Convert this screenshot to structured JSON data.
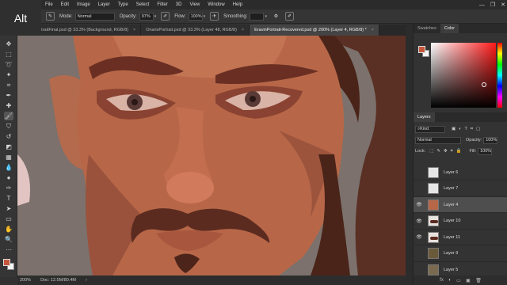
{
  "overlay": {
    "key_label": "Alt"
  },
  "menu": {
    "logo": "Ps",
    "items": [
      "File",
      "Edit",
      "Image",
      "Layer",
      "Type",
      "Select",
      "Filter",
      "3D",
      "View",
      "Window",
      "Help"
    ],
    "window_controls": [
      "—",
      "❐",
      "✕"
    ]
  },
  "options": {
    "mode_label": "Mode:",
    "mode_value": "Normal",
    "opacity_label": "Opacity:",
    "opacity_value": "97%",
    "flow_label": "Flow:",
    "flow_value": "100%",
    "smoothing_label": "Smoothing:",
    "smoothing_value": ""
  },
  "tabs": [
    {
      "label": "EravinPortraitFinal.psd @ 33.3% (Background, RGB/8)",
      "close": "×"
    },
    {
      "label": "OnarisPortrait.psd @ 33.3% (Layer 48, RGB/8)",
      "close": "×"
    },
    {
      "label": "EravinPortrait-Recovered.psd @ 200% (Layer 4, RGB/8) *",
      "close": "×"
    }
  ],
  "status": {
    "zoom": "200%",
    "doc": "Doc: 12.5M/80.4M",
    "arrow": "›"
  },
  "panels": {
    "top_tabs": [
      "Swatches",
      "Color"
    ],
    "layers_tab": "Layers",
    "kind_filter": "Kind",
    "blend_mode": "Normal",
    "opacity_label": "Opacity:",
    "opacity_value": "100%",
    "lock_label": "Lock:",
    "fill_label": "Fill:",
    "fill_value": "100%",
    "layers": [
      {
        "name": "Layer 6",
        "visible": false,
        "selected": false,
        "thumb": "blank"
      },
      {
        "name": "Layer 7",
        "visible": false,
        "selected": false,
        "thumb": "blank"
      },
      {
        "name": "Layer 4",
        "visible": true,
        "selected": true,
        "thumb": "face"
      },
      {
        "name": "Layer 10",
        "visible": true,
        "selected": false,
        "thumb": "mustache"
      },
      {
        "name": "Layer 11",
        "visible": true,
        "selected": false,
        "thumb": "dark"
      },
      {
        "name": "Layer 9",
        "visible": false,
        "selected": false,
        "thumb": "portrait"
      },
      {
        "name": "Layer 5",
        "visible": false,
        "selected": false,
        "thumb": "portrait2"
      }
    ],
    "footer_icons": [
      "fx",
      "◐",
      "▭",
      "▣",
      "🗑"
    ]
  },
  "colors": {
    "foreground": "#c6573c",
    "background": "#f5f5f5",
    "accent": "#31a8ff"
  }
}
